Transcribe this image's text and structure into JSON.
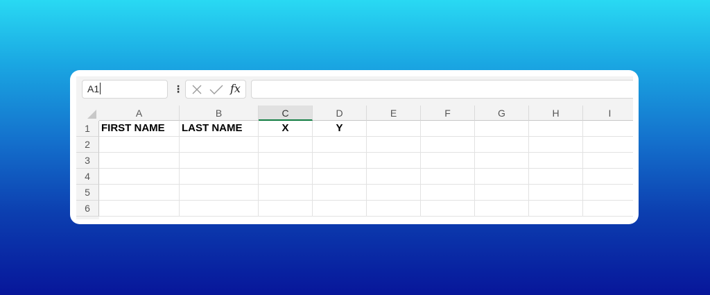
{
  "name_box": {
    "value": "A1"
  },
  "formula_bar": {
    "cancel_icon": "x-icon",
    "enter_icon": "check-icon",
    "function_label": "fx",
    "value": ""
  },
  "columns": [
    "A",
    "B",
    "C",
    "D",
    "E",
    "F",
    "G",
    "H",
    "I"
  ],
  "selected_column": "C",
  "rows": [
    "1",
    "2",
    "3",
    "4",
    "5",
    "6"
  ],
  "cells": {
    "A1": "FIRST NAME",
    "B1": "LAST NAME",
    "C1": "X",
    "D1": "Y"
  },
  "colors": {
    "selection_accent": "#107c41"
  }
}
